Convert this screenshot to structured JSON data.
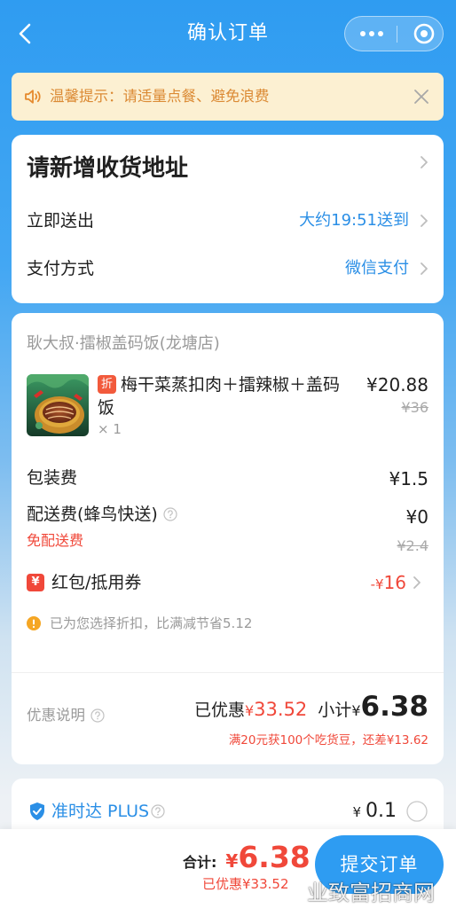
{
  "header": {
    "title": "确认订单",
    "back_icon": "chevron-left-icon",
    "more_icon": "more-dots-icon",
    "exit_icon": "target-circle-icon"
  },
  "notice": {
    "icon": "speaker-icon",
    "text": "温馨提示：请适量点餐、避免浪费",
    "close_icon": "close-icon"
  },
  "delivery": {
    "address_label": "请新增收货地址",
    "time_label": "立即送出",
    "time_value": "大约19:51送到",
    "payment_label": "支付方式",
    "payment_value": "微信支付",
    "chevron_icon": "chevron-right-icon"
  },
  "order": {
    "shop_name": "耿大叔·擂椒盖码饭(龙塘店)",
    "items": [
      {
        "image": "food-photo",
        "badge": "折",
        "name": "梅干菜蒸扣肉＋擂辣椒＋盖码饭",
        "quantity": "× 1",
        "price": "¥20.88",
        "original_price": "¥36"
      }
    ],
    "packaging_label": "包装费",
    "packaging_value": "¥1.5",
    "delivery_fee_label": "配送费(蜂鸟快送)",
    "delivery_fee_value": "¥0",
    "free_delivery_tag": "免配送费",
    "delivery_fee_original": "¥2.4",
    "coupon_badge": "¥",
    "coupon_label": "红包/抵用券",
    "coupon_value_prefix": "-¥",
    "coupon_value": "16",
    "discount_tip_icon": "info-circle-icon",
    "discount_tip": "已为您选择折扣，比满减节省5.12",
    "discount_info_label": "优惠说明",
    "help_icon": "question-circle-icon",
    "saved_label": "已优惠",
    "saved_currency": "¥",
    "saved_value": "33.52",
    "subtotal_label": "小计",
    "subtotal_currency": "¥",
    "subtotal_value": "6.38",
    "bonus_tip": "满20元获100个吃货豆，还差¥13.62"
  },
  "ontime": {
    "icon": "shield-check-icon",
    "label": "准时达 PLUS",
    "price_currency": "¥",
    "price_value": "0.1",
    "selected": false
  },
  "footer": {
    "total_label": "合计:",
    "total_currency": "¥",
    "total_value": "6.38",
    "saved_text": "已优惠¥33.52",
    "submit_label": "提交订单"
  },
  "watermark": "业致富招商网",
  "colors": {
    "primary_blue": "#2e9cf2",
    "link_blue": "#2b8fe6",
    "price_red": "#f0483a",
    "notice_bg": "#fcf0d2",
    "notice_text": "#db8a34",
    "text_main": "#1f1f1f"
  }
}
